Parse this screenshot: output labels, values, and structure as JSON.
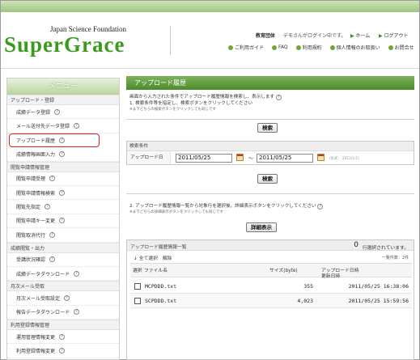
{
  "header": {
    "org_name": "Japan Science Foundation",
    "logo_text": "SuperGrace",
    "user_label": "教育団体",
    "user_text": "デモさんがログイン中です。",
    "home_link": "ホーム",
    "logout_link": "ログアウト",
    "nav": [
      "ご利用ガイド",
      "FAQ",
      "利用規約",
      "個人情報のお取扱い",
      "お問合せ"
    ]
  },
  "sidebar": {
    "menu_title": "メニュー",
    "sections": [
      {
        "title": "アップロード・登録",
        "items": [
          "成績データ登録",
          "メール送付先データ登録",
          "アップロード履歴",
          "成績情報画面入力"
        ]
      },
      {
        "title": "閲覧申請情報管理",
        "items": [
          "閲覧申請受理",
          "閲覧申請情報検索",
          "閲覧先指定",
          "閲覧申請キー変更",
          "閲覧取消代行"
        ]
      },
      {
        "title": "成績閲覧・出力",
        "items": [
          "受講状況確認",
          "成績データダウンロード"
        ]
      },
      {
        "title": "月次メール受取",
        "items": [
          "月次メール受取設定",
          "報告データダウンロード"
        ]
      },
      {
        "title": "利用登録情報管理",
        "items": [
          "運用管理情報変更",
          "利用登録情報変更"
        ]
      }
    ]
  },
  "main": {
    "page_title": "アップロード履歴",
    "desc_line1": "画面から入力された条件でアップロード履歴情報を検索し、表示します",
    "desc_line2": "1. 検索条件等を指定し、検索ボタンをクリックしてください",
    "desc_note1": "※ま下どちらの検索ボタンをクリックしても同じです",
    "search_button_label": "検索",
    "conditions_title": "検索条件",
    "upload_date_label": "アップロード日",
    "date_from": "2011/05/25",
    "date_sep": "～",
    "date_to": "2011/05/25",
    "date_format": "(形式： 2012/1/1)",
    "desc_line3": "2. アップロード履歴情報一覧から対象行を選択後、詳細表示ボタンをクリックしてください",
    "desc_note2": "※ま下どちらの詳細表示ボタンをクリックしても同じです",
    "detail_button_label": "詳細表示"
  },
  "results": {
    "title": "アップロード履歴情報一覧",
    "count": "0",
    "count_text": "行選択されています。",
    "select_all": "全て選択",
    "clear": "解除",
    "total": "一覧件数：2件",
    "columns": [
      "選択",
      "ファイル名",
      "サイズ(byte)",
      "アップロード日時",
      "更新日時"
    ],
    "rows": [
      {
        "filename": "MCPDDD.txt",
        "size": "355",
        "datetime": "2011/05/25 16:38:06"
      },
      {
        "filename": "SCPDDD.txt",
        "size": "4,023",
        "datetime": "2011/05/25 15:59:56"
      }
    ]
  },
  "colors": {
    "brand_green": "#3c9a1f",
    "title_bar": "#4a8b2c",
    "highlight_red": "#e02020"
  }
}
